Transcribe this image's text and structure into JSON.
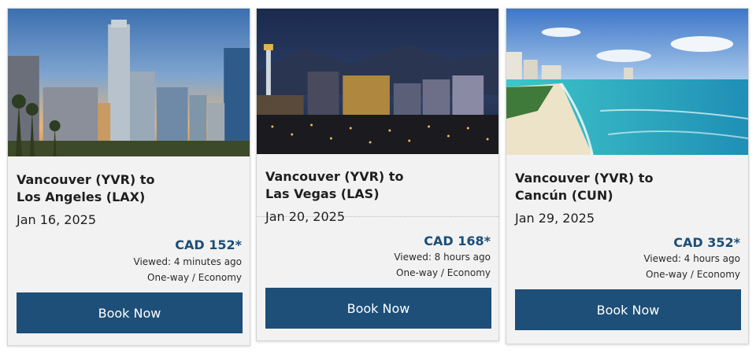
{
  "deals": [
    {
      "route": "Vancouver (YVR) to Los Angeles (LAX)",
      "route_line1": "Vancouver (YVR) to",
      "route_line2": "Los Angeles (LAX)",
      "date": "Jan 16, 2025",
      "price": "CAD 152*",
      "viewed": "Viewed: 4 minutes ago",
      "fare": "One-way / Economy",
      "button": "Book Now",
      "image": "los-angeles-skyline-photo"
    },
    {
      "route": "Vancouver (YVR) to Las Vegas (LAS)",
      "route_line1": "Vancouver (YVR) to",
      "route_line2": "Las Vegas (LAS)",
      "date": "Jan 20, 2025",
      "price": "CAD 168*",
      "viewed": "Viewed: 8 hours ago",
      "fare": "One-way / Economy",
      "button": "Book Now",
      "image": "las-vegas-night-photo"
    },
    {
      "route": "Vancouver (YVR) to Cancún (CUN)",
      "route_line1": "Vancouver (YVR) to",
      "route_line2": "Cancún (CUN)",
      "date": "Jan 29, 2025",
      "price": "CAD 352*",
      "viewed": "Viewed: 4 hours ago",
      "fare": "One-way / Economy",
      "button": "Book Now",
      "image": "cancun-beach-photo"
    }
  ],
  "colors": {
    "card_background": "#f2f2f2",
    "price": "#1c4e77",
    "button": "#1d4f78",
    "button_text": "#ffffff"
  }
}
